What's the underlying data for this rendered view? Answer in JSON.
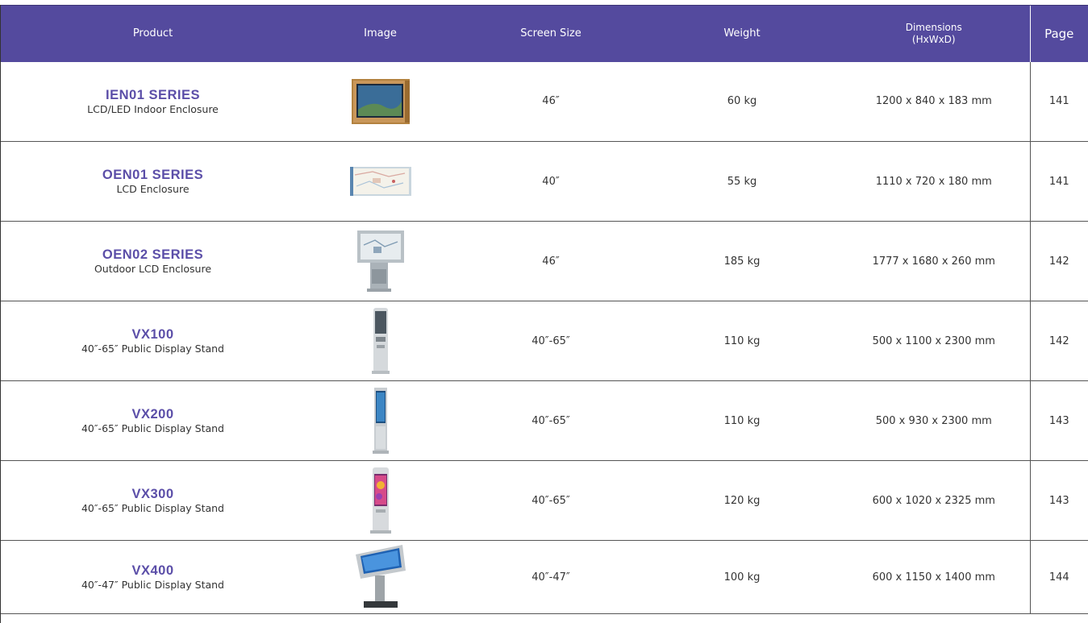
{
  "header": {
    "product": "Product",
    "image": "Image",
    "screen_size": "Screen Size",
    "weight": "Weight",
    "dimensions_line1": "Dimensions",
    "dimensions_line2": "(HxWxD)",
    "page": "Page"
  },
  "colors": {
    "header_bg": "#544a9e",
    "product_name": "#5b4ea8"
  },
  "rows": [
    {
      "name": "IEN01 SERIES",
      "desc": "LCD/LED Indoor Enclosure",
      "image_icon": "wood-framed-display-icon",
      "screen": "46″",
      "weight": "60 kg",
      "dimensions": "1200 x 840 x 183 mm",
      "page": "141"
    },
    {
      "name": "OEN01 SERIES",
      "desc": "LCD Enclosure",
      "image_icon": "map-display-enclosure-icon",
      "screen": "40″",
      "weight": "55 kg",
      "dimensions": "1110 x 720 x 180 mm",
      "page": "141"
    },
    {
      "name": "OEN02 SERIES",
      "desc": "Outdoor LCD Enclosure",
      "image_icon": "outdoor-display-stand-icon",
      "screen": "46″",
      "weight": "185 kg",
      "dimensions": "1777 x 1680 x 260 mm",
      "page": "142"
    },
    {
      "name": "VX100",
      "desc": "40″-65″ Public Display Stand",
      "image_icon": "tall-kiosk-icon",
      "screen": "40″-65″",
      "weight": "110 kg",
      "dimensions": "500 x 1100 x 2300 mm",
      "page": "142"
    },
    {
      "name": "VX200",
      "desc": "40″-65″ Public Display Stand",
      "image_icon": "slim-kiosk-icon",
      "screen": "40″-65″",
      "weight": "110 kg",
      "dimensions": "500 x 930 x 2300 mm",
      "page": "143"
    },
    {
      "name": "VX300",
      "desc": "40″-65″ Public Display Stand",
      "image_icon": "colorful-kiosk-icon",
      "screen": "40″-65″",
      "weight": "120 kg",
      "dimensions": "600 x 1020 x 2325 mm",
      "page": "143"
    },
    {
      "name": "VX400",
      "desc": "40″-47″ Public Display Stand",
      "image_icon": "table-kiosk-icon",
      "screen": "40″-47″",
      "weight": "100 kg",
      "dimensions": "600 x 1150 x 1400 mm",
      "page": "144"
    }
  ]
}
